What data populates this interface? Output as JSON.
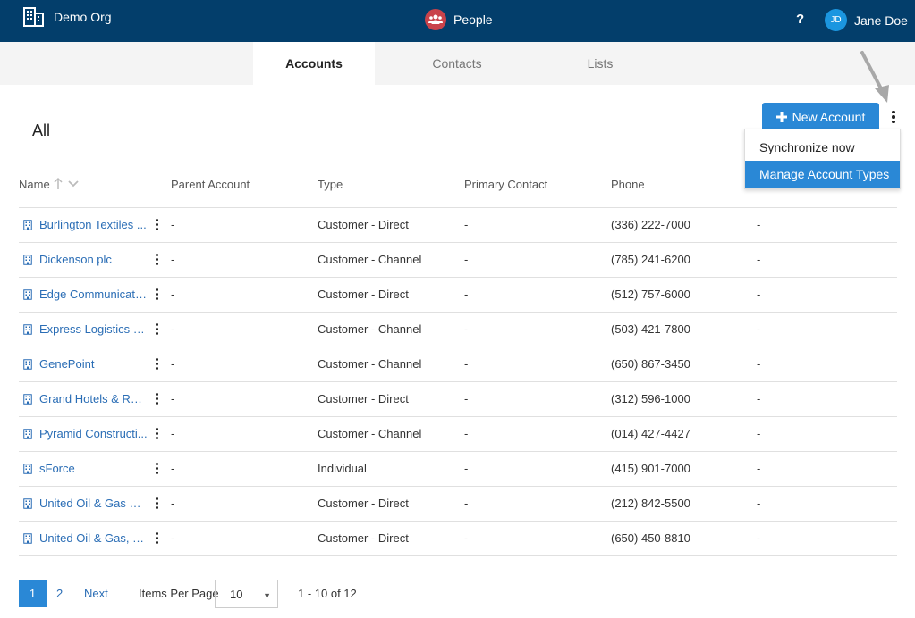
{
  "topbar": {
    "org_name": "Demo Org",
    "app_name": "People",
    "help": "?",
    "user_initials": "JD",
    "user_name": "Jane Doe"
  },
  "tabs": [
    {
      "label": "Accounts",
      "active": true
    },
    {
      "label": "Contacts",
      "active": false
    },
    {
      "label": "Lists",
      "active": false
    }
  ],
  "page": {
    "title": "All",
    "new_button": "New Account"
  },
  "menu": {
    "items": [
      "Synchronize now",
      "Manage Account Types"
    ],
    "highlighted": "Manage Account Types"
  },
  "table": {
    "columns": [
      "Name",
      "Parent Account",
      "Type",
      "Primary Contact",
      "Phone"
    ],
    "rows": [
      {
        "name": "Burlington Textiles ...",
        "parent": "-",
        "type": "Customer - Direct",
        "contact": "-",
        "phone": "(336) 222-7000",
        "extra": "-"
      },
      {
        "name": "Dickenson plc",
        "parent": "-",
        "type": "Customer - Channel",
        "contact": "-",
        "phone": "(785) 241-6200",
        "extra": "-"
      },
      {
        "name": "Edge Communicatio...",
        "parent": "-",
        "type": "Customer - Direct",
        "contact": "-",
        "phone": "(512) 757-6000",
        "extra": "-"
      },
      {
        "name": "Express Logistics an...",
        "parent": "-",
        "type": "Customer - Channel",
        "contact": "-",
        "phone": "(503) 421-7800",
        "extra": "-"
      },
      {
        "name": "GenePoint",
        "parent": "-",
        "type": "Customer - Channel",
        "contact": "-",
        "phone": "(650) 867-3450",
        "extra": "-"
      },
      {
        "name": "Grand Hotels & Res...",
        "parent": "-",
        "type": "Customer - Direct",
        "contact": "-",
        "phone": "(312) 596-1000",
        "extra": "-"
      },
      {
        "name": "Pyramid Constructi...",
        "parent": "-",
        "type": "Customer - Channel",
        "contact": "-",
        "phone": "(014) 427-4427",
        "extra": "-"
      },
      {
        "name": "sForce",
        "parent": "-",
        "type": "Individual",
        "contact": "-",
        "phone": "(415) 901-7000",
        "extra": "-"
      },
      {
        "name": "United Oil & Gas Co...",
        "parent": "-",
        "type": "Customer - Direct",
        "contact": "-",
        "phone": "(212) 842-5500",
        "extra": "-"
      },
      {
        "name": "United Oil & Gas, Si...",
        "parent": "-",
        "type": "Customer - Direct",
        "contact": "-",
        "phone": "(650) 450-8810",
        "extra": "-"
      }
    ]
  },
  "pagination": {
    "current": "1",
    "page2": "2",
    "next": "Next",
    "items_per_page_label": "Items Per Page",
    "items_per_page": "10",
    "range": "1 - 10 of 12"
  },
  "colors": {
    "topbar": "#033e6b",
    "accent": "#2a88d6",
    "app_icon": "#c9434b",
    "avatar": "#1b96e0"
  },
  "icons": {
    "org": "building-icon",
    "app": "people-icon",
    "row": "account-icon",
    "sort": "arrow-up-icon",
    "kebab": "more-vertical-icon"
  }
}
